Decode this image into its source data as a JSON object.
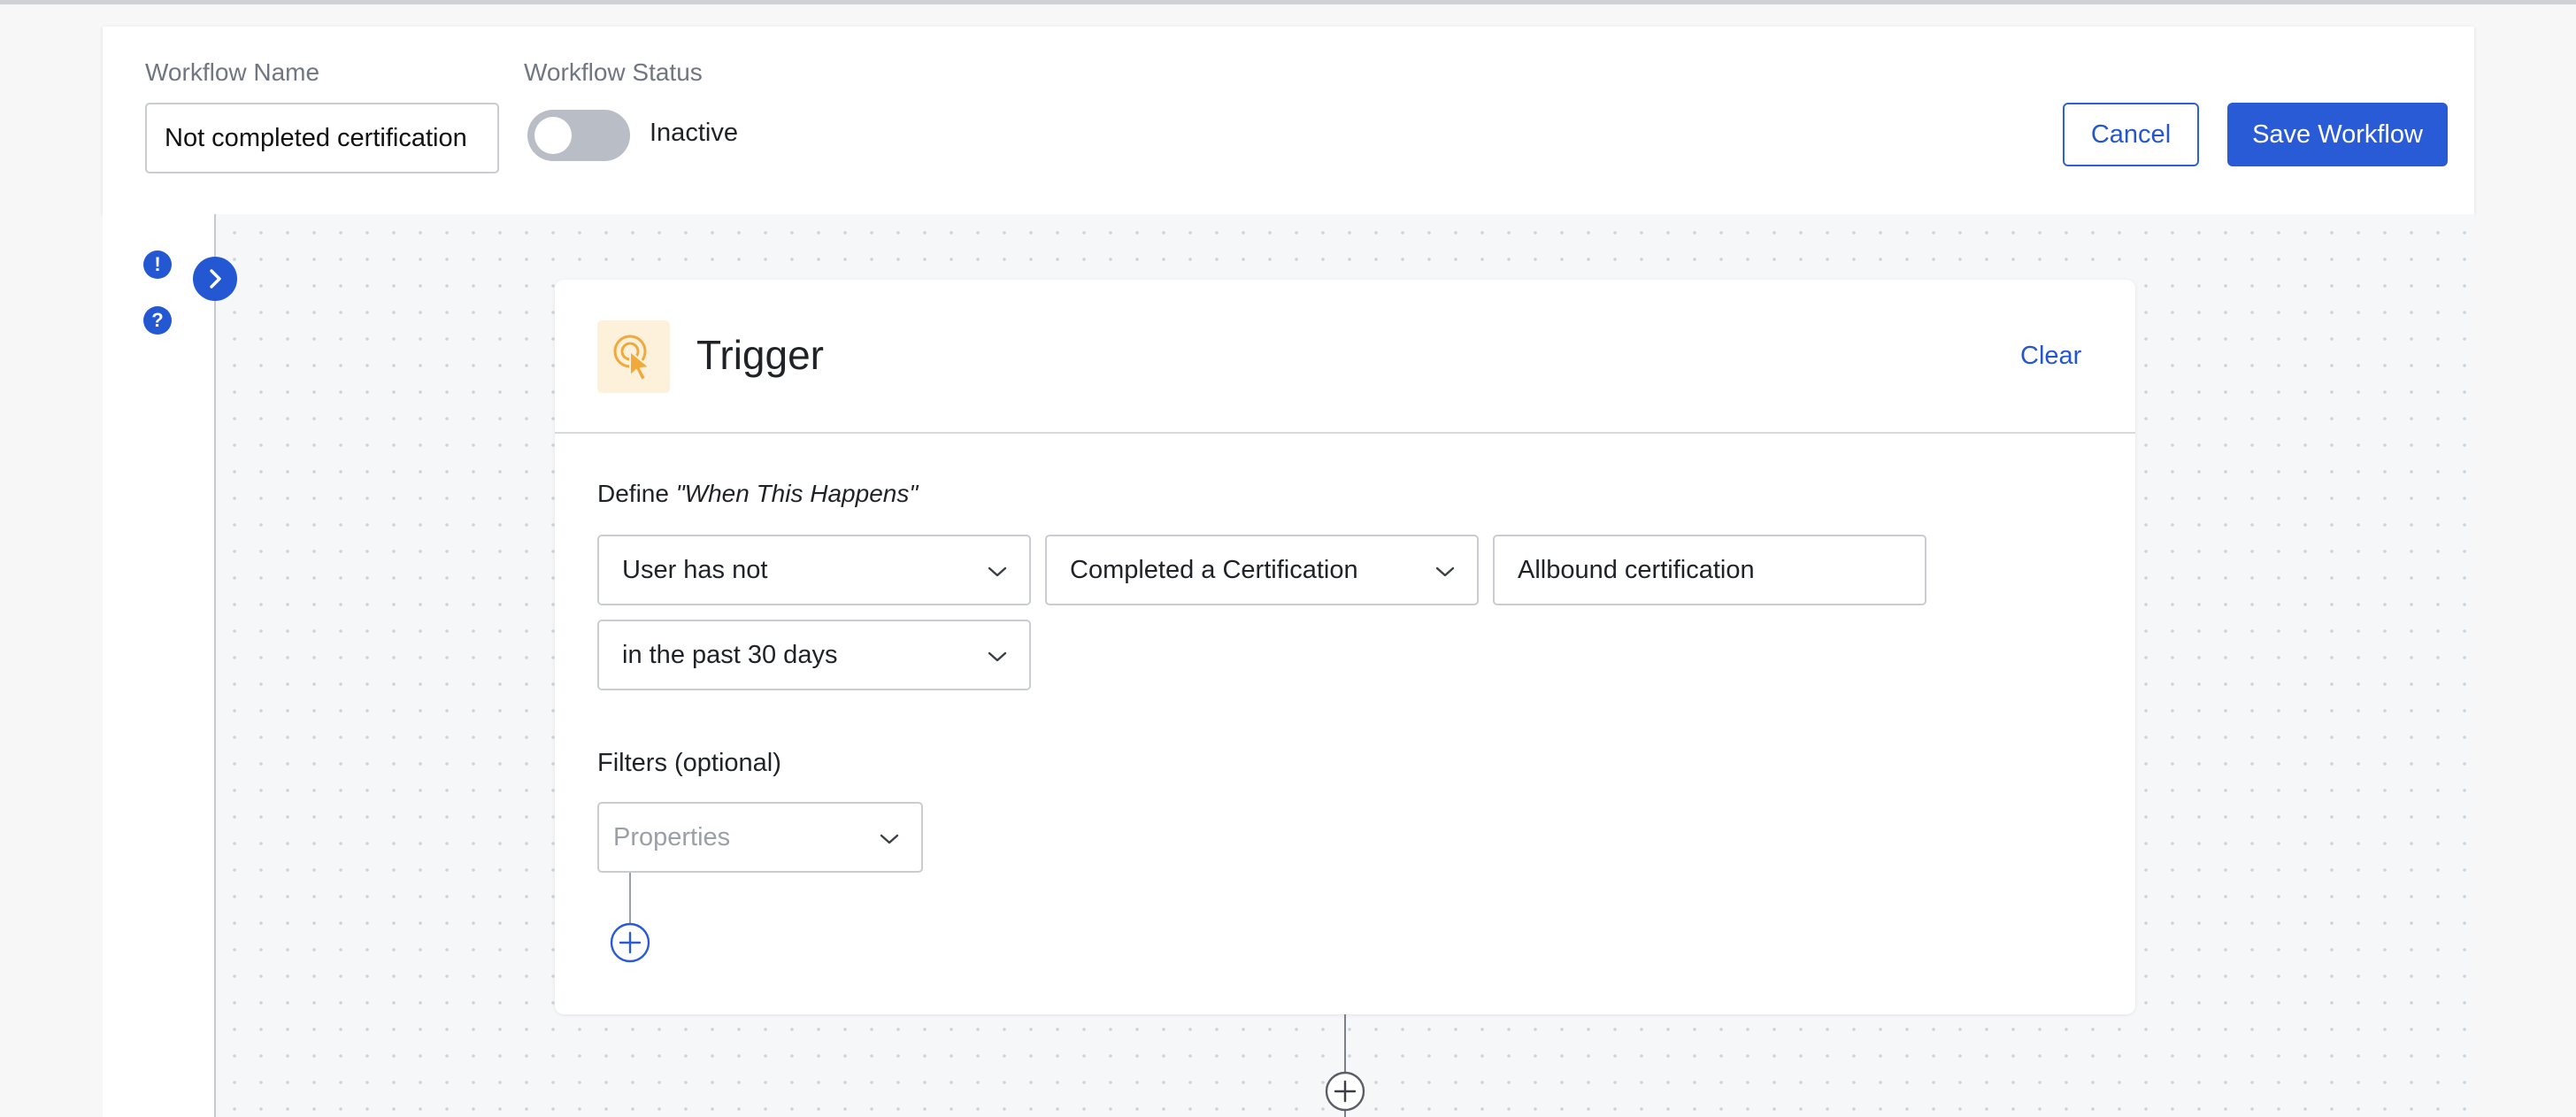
{
  "header": {
    "workflow_name_label": "Workflow Name",
    "workflow_name_value": "Not completed certification",
    "workflow_status_label": "Workflow Status",
    "status_text": "Inactive",
    "cancel_label": "Cancel",
    "save_label": "Save Workflow"
  },
  "sidebar": {
    "alert_icon": "!",
    "help_icon": "?"
  },
  "trigger": {
    "title": "Trigger",
    "clear_label": "Clear",
    "define_prefix": "Define ",
    "define_emphasis": "\"When This Happens\"",
    "condition_subject": "User has not",
    "condition_event": "Completed a Certification",
    "condition_target": "Allbound certification",
    "condition_timeframe": "in the past 30 days",
    "filters_label": "Filters (optional)",
    "properties_placeholder": "Properties"
  },
  "colors": {
    "primary": "#2a5bd7",
    "toggle_off": "#b9bec6",
    "trigger_icon_bg": "#fdf1dc",
    "trigger_icon": "#f0a93a"
  },
  "icons": {
    "trigger": "pointer-click-icon",
    "expand": "chevron-right-icon",
    "dropdown": "chevron-down-icon",
    "add": "plus-circle-icon"
  }
}
